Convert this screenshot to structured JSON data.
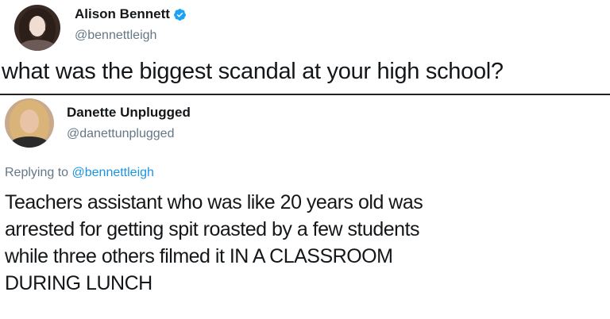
{
  "tweet": {
    "author_name": "Alison Bennett",
    "author_handle": "@bennettleigh",
    "text": "what was the biggest scandal at your high school?",
    "verified_icon": "verified-badge-icon",
    "avatar_icon": "avatar"
  },
  "reply": {
    "author_name": "Danette Unplugged",
    "author_handle": "@danettunplugged",
    "replying_to_label": "Replying to",
    "replying_to_handle": "@bennettleigh",
    "text_lines": [
      "Teachers assistant who was like 20 years old was",
      "arrested for getting spit roasted by a few students",
      "while three others filmed it IN A CLASSROOM",
      "DURING LUNCH"
    ],
    "avatar_icon": "avatar"
  },
  "colors": {
    "text": "#14171a",
    "secondary": "#657786",
    "link": "#1b95e0",
    "verified": "#1da1f2",
    "divider": "#222222"
  }
}
